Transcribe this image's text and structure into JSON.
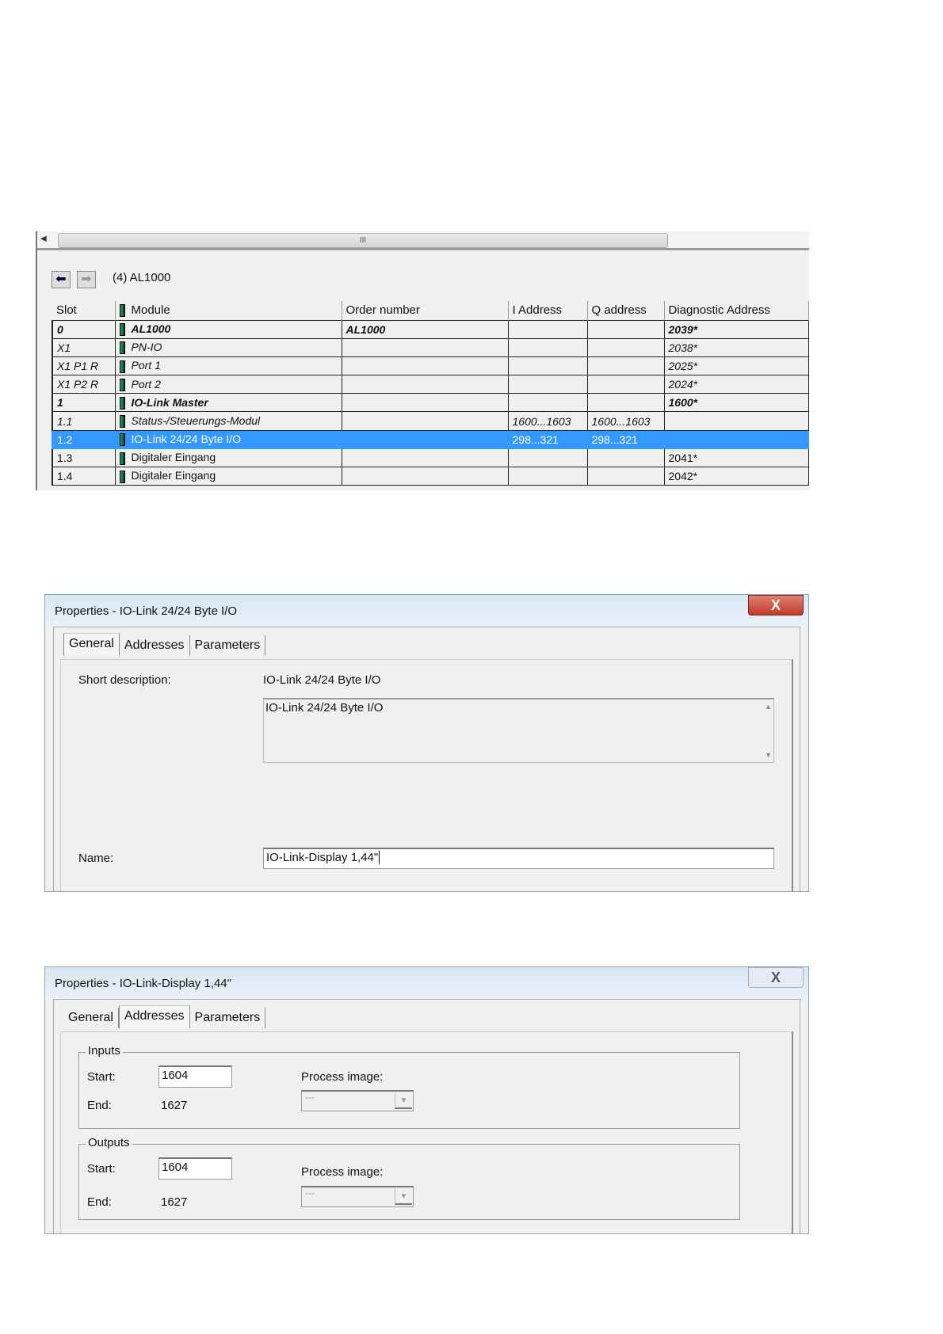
{
  "hw_config": {
    "station": "(4)  AL1000",
    "scroll_grip": "III",
    "columns": [
      "Slot",
      "Module",
      "Order number",
      "I Address",
      "Q address",
      "Diagnostic Address"
    ],
    "rows": [
      {
        "slot": "0",
        "module": "AL1000",
        "order": "AL1000",
        "i": "",
        "q": "",
        "diag": "2039*",
        "style": "bd"
      },
      {
        "slot": "X1",
        "module": "PN-IO",
        "order": "",
        "i": "",
        "q": "",
        "diag": "2038*",
        "style": "it"
      },
      {
        "slot": "X1 P1 R",
        "module": "Port 1",
        "order": "",
        "i": "",
        "q": "",
        "diag": "2025*",
        "style": "it"
      },
      {
        "slot": "X1 P2 R",
        "module": "Port 2",
        "order": "",
        "i": "",
        "q": "",
        "diag": "2024*",
        "style": "it"
      },
      {
        "slot": "1",
        "module": "IO-Link Master",
        "order": "",
        "i": "",
        "q": "",
        "diag": "1600*",
        "style": "bd"
      },
      {
        "slot": "1.1",
        "module": "Status-/Steuerungs-Modul",
        "order": "",
        "i": "1600...1603",
        "q": "1600...1603",
        "diag": "",
        "style": "it"
      },
      {
        "slot": "1.2",
        "module": "IO-Link 24/24 Byte I/O",
        "order": "",
        "i": "298...321",
        "q": "298...321",
        "diag": "",
        "style": "sel"
      },
      {
        "slot": "1.3",
        "module": "Digitaler Eingang",
        "order": "",
        "i": "",
        "q": "",
        "diag": "2041*",
        "style": ""
      },
      {
        "slot": "1.4",
        "module": "Digitaler Eingang",
        "order": "",
        "i": "",
        "q": "",
        "diag": "2042*",
        "style": ""
      }
    ]
  },
  "dialog1": {
    "title": "Properties - IO-Link 24/24 Byte I/O",
    "close": "X",
    "tabs": [
      "General",
      "Addresses",
      "Parameters"
    ],
    "short_desc_label": "Short description:",
    "short_desc": "IO-Link 24/24 Byte I/O",
    "desc_text": "IO-Link 24/24 Byte I/O",
    "name_label": "Name:",
    "name_value": "IO-Link-Display 1,44\""
  },
  "dialog2": {
    "title": "Properties - IO-Link-Display 1,44\"",
    "close": "X",
    "tabs": [
      "General",
      "Addresses",
      "Parameters"
    ],
    "inputs": {
      "legend": "Inputs",
      "start_label": "Start:",
      "start": "1604",
      "end_label": "End:",
      "end": "1627",
      "pi_label": "Process image:",
      "pi_value": "---"
    },
    "outputs": {
      "legend": "Outputs",
      "start_label": "Start:",
      "start": "1604",
      "end_label": "End:",
      "end": "1627",
      "pi_label": "Process image:",
      "pi_value": "---"
    }
  }
}
